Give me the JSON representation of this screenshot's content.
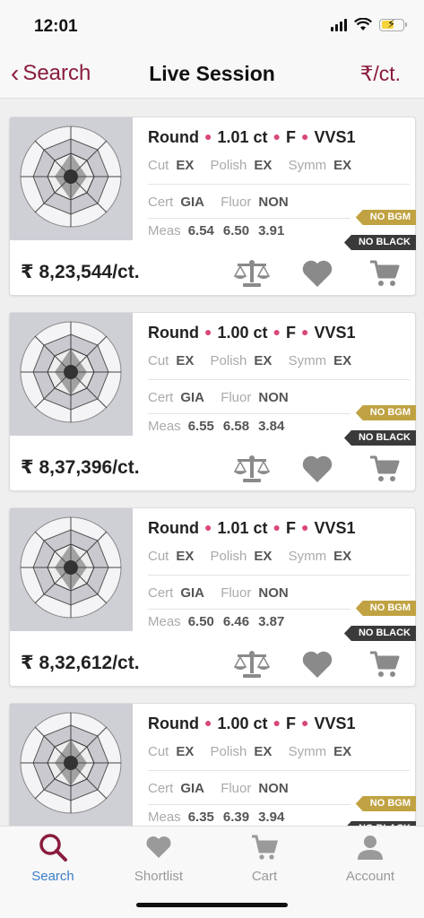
{
  "status": {
    "time": "12:01"
  },
  "nav": {
    "back_label": "Search",
    "title": "Live Session",
    "right_label": "₹/ct."
  },
  "labels": {
    "cut": "Cut",
    "polish": "Polish",
    "symm": "Symm",
    "cert": "Cert",
    "fluor": "Fluor",
    "meas": "Meas",
    "tag_bgm": "NO BGM",
    "tag_black": "NO BLACK"
  },
  "currency": "₹",
  "listings": [
    {
      "shape": "Round",
      "carat": "1.01 ct",
      "color": "F",
      "clarity": "VVS1",
      "cut": "EX",
      "polish": "EX",
      "symm": "EX",
      "cert": "GIA",
      "fluor": "NON",
      "meas": [
        "6.54",
        "6.50",
        "3.91"
      ],
      "price": "8,23,544/ct."
    },
    {
      "shape": "Round",
      "carat": "1.00 ct",
      "color": "F",
      "clarity": "VVS1",
      "cut": "EX",
      "polish": "EX",
      "symm": "EX",
      "cert": "GIA",
      "fluor": "NON",
      "meas": [
        "6.55",
        "6.58",
        "3.84"
      ],
      "price": "8,37,396/ct."
    },
    {
      "shape": "Round",
      "carat": "1.01 ct",
      "color": "F",
      "clarity": "VVS1",
      "cut": "EX",
      "polish": "EX",
      "symm": "EX",
      "cert": "GIA",
      "fluor": "NON",
      "meas": [
        "6.50",
        "6.46",
        "3.87"
      ],
      "price": "8,32,612/ct."
    },
    {
      "shape": "Round",
      "carat": "1.00 ct",
      "color": "F",
      "clarity": "VVS1",
      "cut": "EX",
      "polish": "EX",
      "symm": "EX",
      "cert": "GIA",
      "fluor": "NON",
      "meas": [
        "6.35",
        "6.39",
        "3.94"
      ],
      "price": ""
    }
  ],
  "tabs": [
    {
      "label": "Search",
      "icon": "search-icon",
      "active": true
    },
    {
      "label": "Shortlist",
      "icon": "heart-icon",
      "active": false
    },
    {
      "label": "Cart",
      "icon": "cart-icon",
      "active": false
    },
    {
      "label": "Account",
      "icon": "account-icon",
      "active": false
    }
  ],
  "colors": {
    "brand": "#8a1c3c",
    "active_tab": "#3a7ec9",
    "tag_gold": "#c0a242",
    "tag_black": "#3a3a3a",
    "dot": "#d9477a"
  }
}
